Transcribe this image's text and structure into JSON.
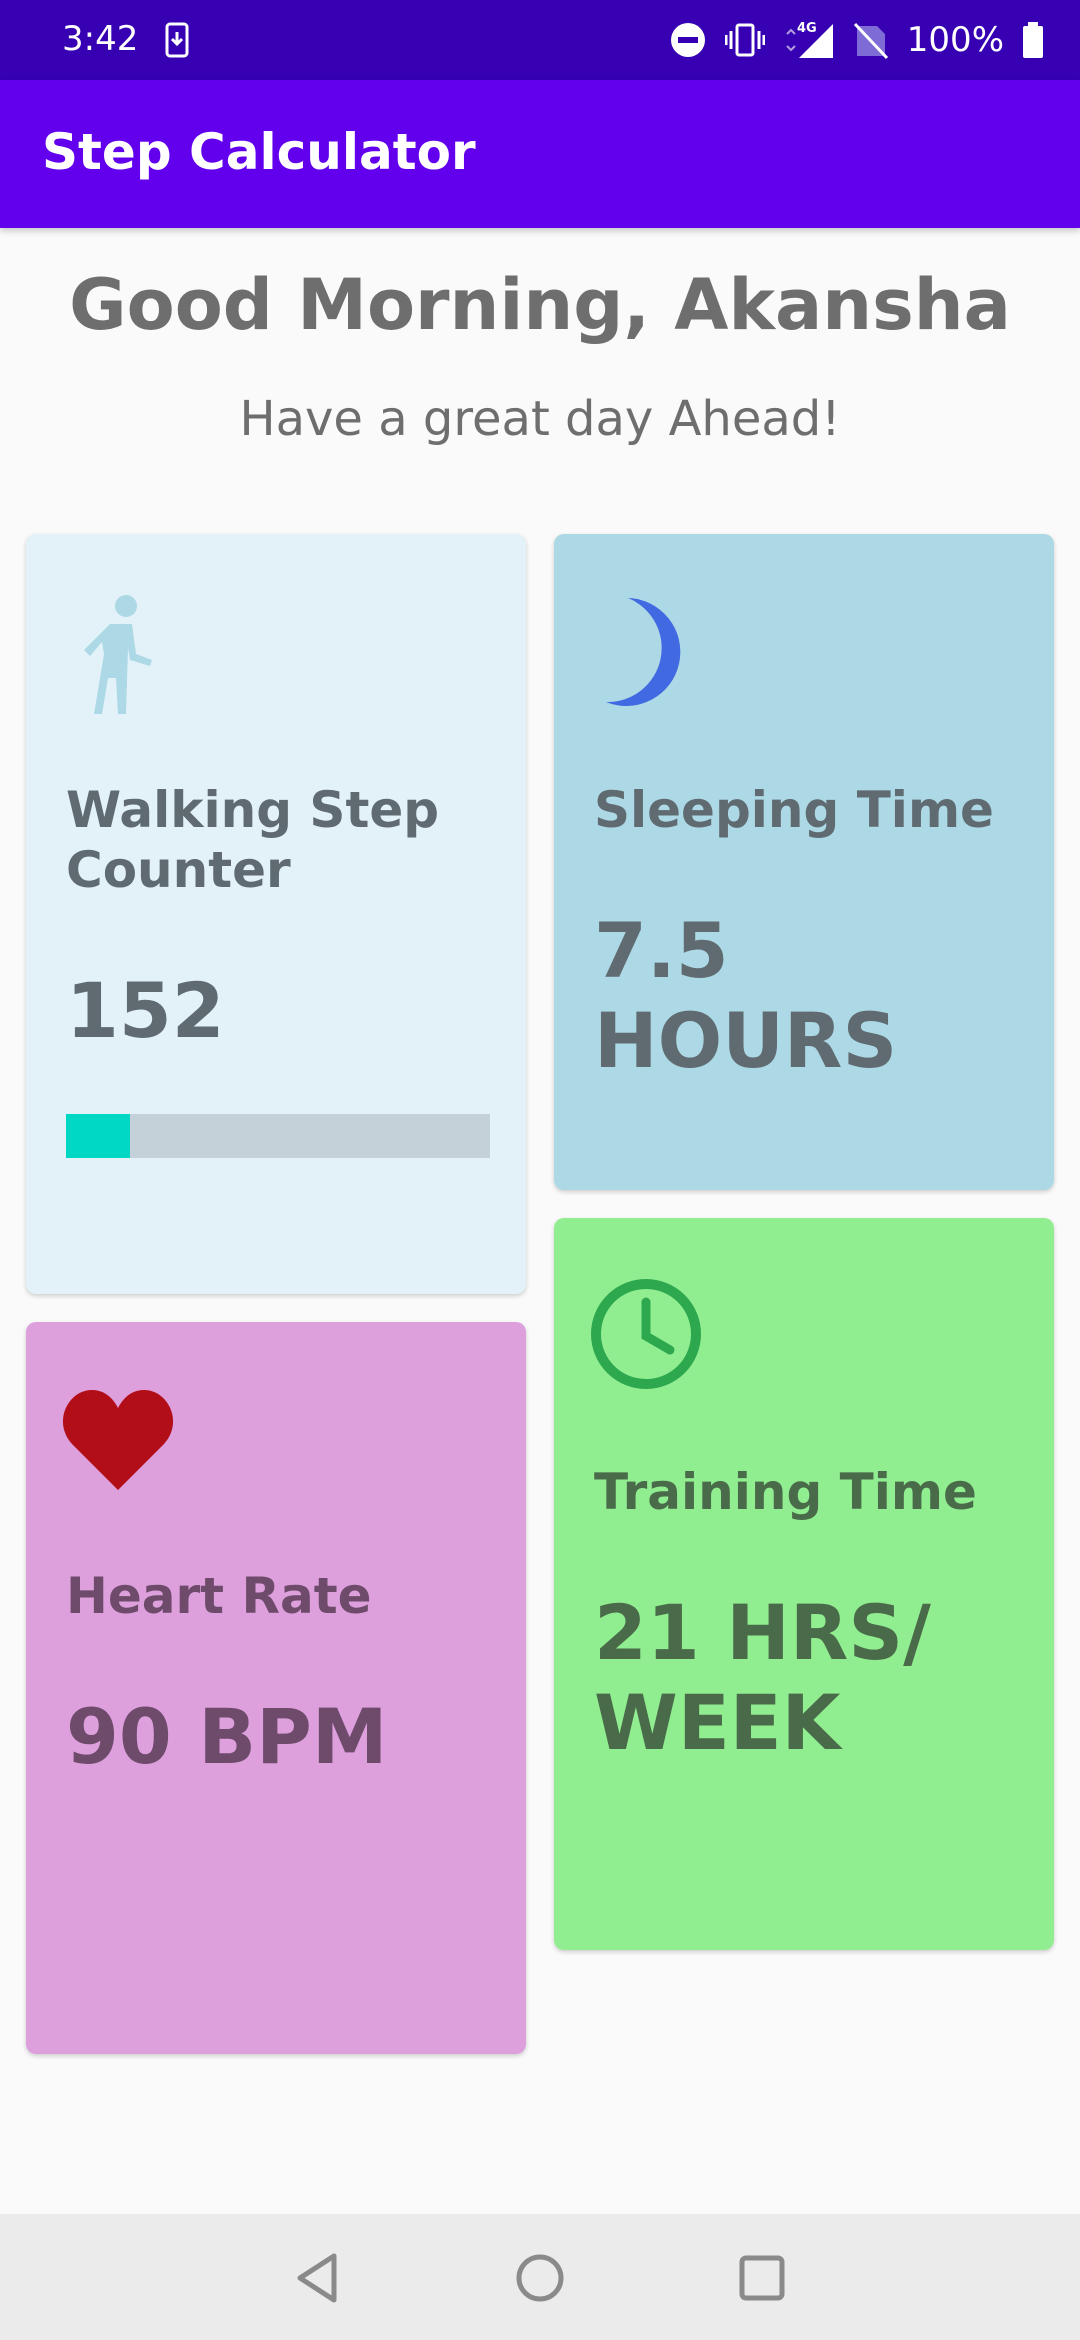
{
  "status_bar": {
    "time": "3:42",
    "battery": "100%",
    "network": "4G",
    "icons": [
      "download-icon",
      "do-not-disturb-icon",
      "vibrate-icon",
      "signal-icon",
      "no-sim-icon",
      "battery-icon"
    ]
  },
  "app_bar": {
    "title": "Step Calculator"
  },
  "greeting": {
    "title": "Good Morning, Akansha",
    "subtitle": "Have a great day Ahead!"
  },
  "cards": {
    "steps": {
      "icon": "walking-icon",
      "title_line1": "Walking Step",
      "title_line2": "Counter",
      "value": "152",
      "progress": 0.15,
      "color": "#e3f2f9"
    },
    "sleep": {
      "icon": "moon-icon",
      "title": "Sleeping Time",
      "value": "7.5 HOURS",
      "color": "#add8e6"
    },
    "heart": {
      "icon": "heart-icon",
      "title": "Heart Rate",
      "value": "90 BPM",
      "color": "#dda0dd"
    },
    "training": {
      "icon": "clock-icon",
      "title": "Training Time",
      "value_line1": "21 HRS/",
      "value_line2": "WEEK",
      "color": "#90ee90"
    }
  },
  "nav_bar": {
    "buttons": [
      "back-icon",
      "home-icon",
      "recents-icon"
    ]
  },
  "colors": {
    "status_bar": "#3700b3",
    "app_bar": "#6200ee",
    "progress_fill": "#00d8c6"
  }
}
